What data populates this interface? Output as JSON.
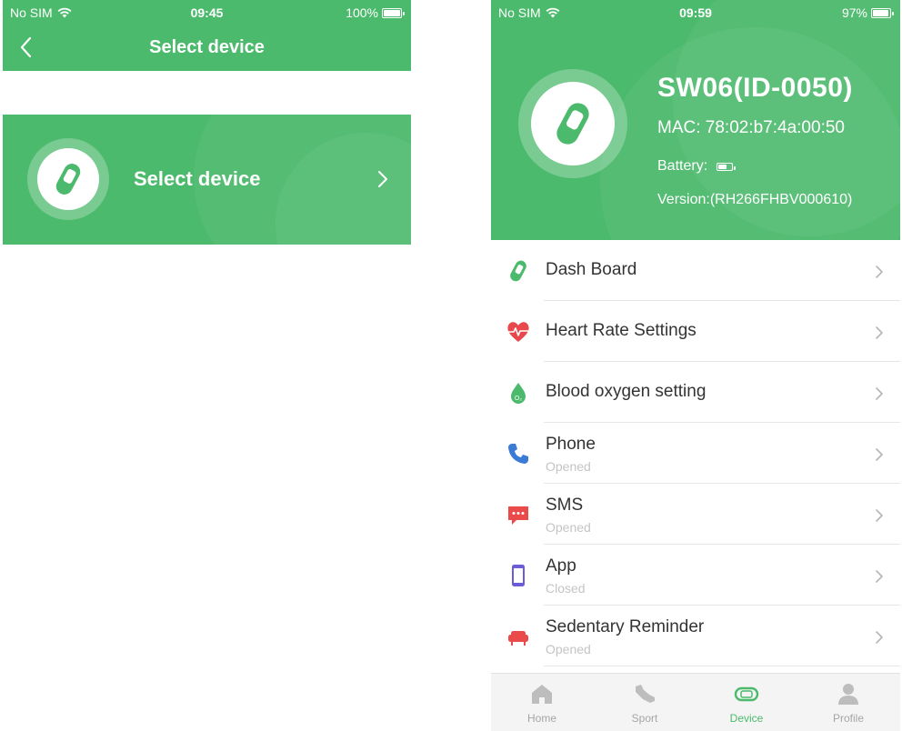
{
  "colors": {
    "accent": "#4cba6c",
    "heart": "#e8474c",
    "phone": "#3a7bd5",
    "app": "#6b5bd6",
    "sms": "#ea4a4a"
  },
  "left_screen": {
    "status": {
      "carrier": "No SIM",
      "time": "09:45",
      "battery": "100%",
      "battery_level": 1.0
    },
    "nav": {
      "title": "Select device",
      "back_icon": "chevron-left-icon"
    },
    "card": {
      "label": "Select device",
      "icon": "band-icon",
      "chevron_icon": "chevron-right-icon"
    }
  },
  "right_screen": {
    "status": {
      "carrier": "No SIM",
      "time": "09:59",
      "battery": "97%",
      "battery_level": 0.97
    },
    "device": {
      "name": "SW06(ID-0050)",
      "mac": "MAC: 78:02:b7:4a:00:50",
      "battery_label": "Battery:",
      "battery_level": 0.6,
      "version": "Version:(RH266FHBV000610)",
      "icon": "band-icon"
    },
    "menu": [
      {
        "title": "Dash Board",
        "sub": "",
        "icon": "band-icon"
      },
      {
        "title": "Heart Rate Settings",
        "sub": "",
        "icon": "heart-rate-icon"
      },
      {
        "title": "Blood oxygen setting",
        "sub": "",
        "icon": "blood-oxygen-icon"
      },
      {
        "title": "Phone",
        "sub": "Opened",
        "icon": "phone-icon"
      },
      {
        "title": "SMS",
        "sub": "Opened",
        "icon": "sms-icon"
      },
      {
        "title": "App",
        "sub": "Closed",
        "icon": "app-icon"
      },
      {
        "title": "Sedentary Reminder",
        "sub": "Opened",
        "icon": "sofa-icon"
      }
    ],
    "tabs": [
      {
        "label": "Home",
        "icon": "home-icon",
        "active": false
      },
      {
        "label": "Sport",
        "icon": "sport-shoe-icon",
        "active": false
      },
      {
        "label": "Device",
        "icon": "band-icon",
        "active": true
      },
      {
        "label": "Profile",
        "icon": "profile-icon",
        "active": false
      }
    ]
  }
}
